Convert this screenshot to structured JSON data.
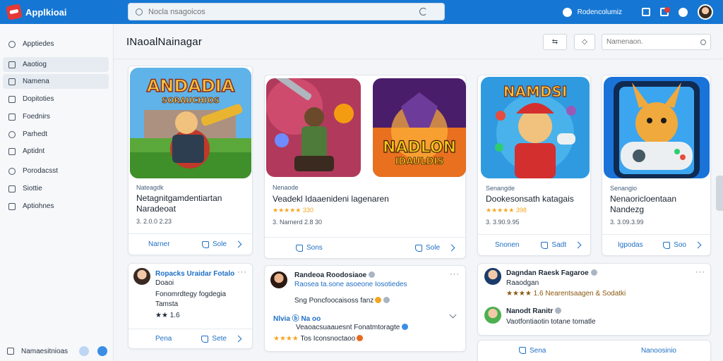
{
  "app": {
    "logo_text": "Applkioai"
  },
  "search": {
    "placeholder": "Nocla nsagoicos"
  },
  "topbar": {
    "link_label": "Rodencolumiz",
    "icons": [
      "chat-icon",
      "grid-icon",
      "bell-icon",
      "camera-icon"
    ]
  },
  "sidebar": {
    "items": [
      {
        "label": "Apptiedes",
        "icon": "compass-icon"
      },
      {
        "label": "Aaotiog",
        "icon": "home-icon"
      },
      {
        "label": "Namena",
        "icon": "printer-icon"
      },
      {
        "label": "Dopitoties",
        "icon": "list-icon"
      },
      {
        "label": "Foednirs",
        "icon": "doc-icon"
      },
      {
        "label": "Parhedt",
        "icon": "shield-icon"
      },
      {
        "label": "Aptidnt",
        "icon": "doc-icon"
      },
      {
        "label": "Porodacsst",
        "icon": "phone-icon"
      },
      {
        "label": "Siottie",
        "icon": "home-icon"
      },
      {
        "label": "Aptiohnes",
        "icon": "doc-icon"
      }
    ],
    "footer_label": "Namaesitnioas"
  },
  "main": {
    "title": "INaoalNainagar",
    "tool1": "⇆",
    "tool2": "◇",
    "search_placeholder": "Namenaon."
  },
  "apps": [
    {
      "category": "Nateagdk",
      "name": "Netagnitgamdentiartan Naradeoat",
      "meta": "3. 2.0.0 2.23",
      "action_left": "Narner",
      "action_right": "Sole"
    },
    {
      "category": "Nenaode",
      "name": "Veadekl Idaaenideni lagenaren",
      "meta": "★★★★★ 330",
      "meta2": "3. Narnerd 2.8 30",
      "action_left": "Sons",
      "action_right": "Sole"
    },
    {
      "category": "Senangde",
      "name": "Dookesonsath katagais",
      "meta": "★★★★★ 398",
      "meta2": "3. 3.90.9.95",
      "action_left": "Snonen",
      "action_right": "Sadt"
    },
    {
      "category": "Senangio",
      "name": "Nenaoricloentaan Nandezg",
      "meta": "3. 3.09.3.99",
      "action_left": "Igpodas",
      "action_right": "Soo"
    }
  ],
  "art_titles": [
    "ANDADIA",
    "SORAUCHIOS",
    "NADLON",
    "IDAULDIS",
    "NAMDSI"
  ],
  "reviews": [
    {
      "lines": [
        "Ropacks Uraidar Fotalo",
        "Doaoi",
        "Fonomrdtegy fogdegia",
        "Tamsta",
        "★★ 1.6"
      ],
      "action_left": "Pena",
      "action_right": "Sete"
    },
    {
      "lines": [
        "Randeoa Roodosiaoe",
        "Raosea ta.sone asoeone Iosotiedes",
        "Sng Poncfoocaisoss fanz",
        "Nlvia ⓑ Na oo",
        "Veaoacsuaauesnt Fonatmtoragte",
        "Tos Iconsnoctaoo"
      ]
    },
    {
      "lines": [
        "Dagndan Raesk Fagaroe",
        "Raaodgan",
        "★★★★ 1.6 Nearentsaagen & Sodatki",
        "Nanodt Ranitr",
        "Vaotfontiaotin totane tomatle"
      ],
      "action_left": "Sena",
      "action_right": "Nanoosinio"
    }
  ]
}
